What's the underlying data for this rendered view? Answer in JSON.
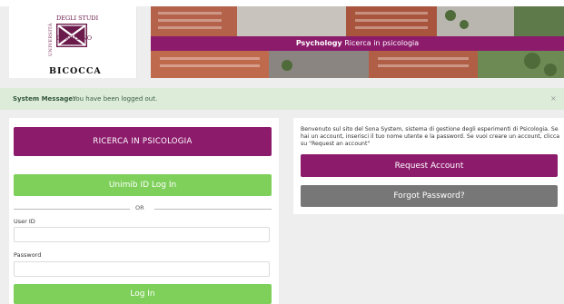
{
  "header": {
    "logo": {
      "side_text": "UNIVERSITÀ",
      "top_text": "DEGLI STUDI",
      "mid_text": "DI MILANO",
      "name": "BICOCCA"
    },
    "banner": {
      "strong": "Psychology",
      "text": "Ricerca in psicologia"
    }
  },
  "system_message": {
    "label": "System Message:",
    "text": "You have been logged out.",
    "close": "×"
  },
  "login": {
    "research_button": "RICERCA IN PSICOLOGIA",
    "unimib_button": "Unimib ID Log In",
    "or_text": "OR",
    "userid_label": "User ID",
    "password_label": "Password",
    "login_button": "Log In"
  },
  "info": {
    "welcome": "Benvenuto sul sito del Sona System, sistema di gestione degli esperimenti di Psicologia. Se hai un account, inserisci il tuo nome utente e la password. Se vuoi creare un account, clicca su \"Request an account\"",
    "request_button": "Request Account",
    "forgot_button": "Forgot Password?"
  },
  "colors": {
    "brand": "#8c1b6c",
    "success": "#7ed05a",
    "message_bg": "#dcecd8",
    "neutral_button": "#777777"
  }
}
